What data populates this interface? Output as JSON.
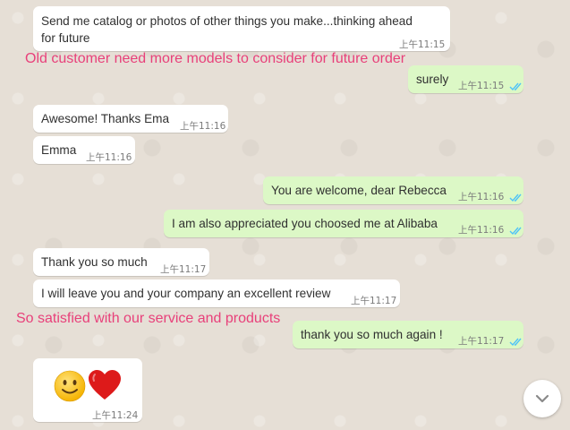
{
  "messages": [
    {
      "text_line1": "Send me catalog or photos of other things you make...thinking ahead",
      "text_line2": "for future",
      "time": "上午11:15"
    },
    {
      "text": "surely",
      "time": "上午11:15"
    },
    {
      "text": "Awesome! Thanks Ema",
      "time": "上午11:16"
    },
    {
      "text": "Emma",
      "time": "上午11:16"
    },
    {
      "text": "You are welcome, dear Rebecca",
      "time": "上午11:16"
    },
    {
      "text": "I am also appreciated you choosed me at Alibaba",
      "time": "上午11:16"
    },
    {
      "text": "Thank you so much",
      "time": "上午11:17"
    },
    {
      "text": "I will leave you and your company an excellent review",
      "time": "上午11:17"
    },
    {
      "text": "thank you so much again !",
      "time": "上午11:17"
    },
    {
      "emojis": [
        "slightly-smiling-face",
        "red-heart"
      ],
      "time": "上午11:24"
    }
  ],
  "annotations": {
    "note1": "Old customer need more models to consider for future order",
    "note2": "So satisfied with our service and products"
  },
  "colors": {
    "incoming_bubble": "#ffffff",
    "outgoing_bubble": "#dcf8c6",
    "read_ticks": "#4fc3f7",
    "annotation_text": "#e8407a",
    "background": "#e5ddd5"
  },
  "icons": {
    "read_receipt": "double-check-icon",
    "scroll_down": "chevron-down-icon"
  }
}
